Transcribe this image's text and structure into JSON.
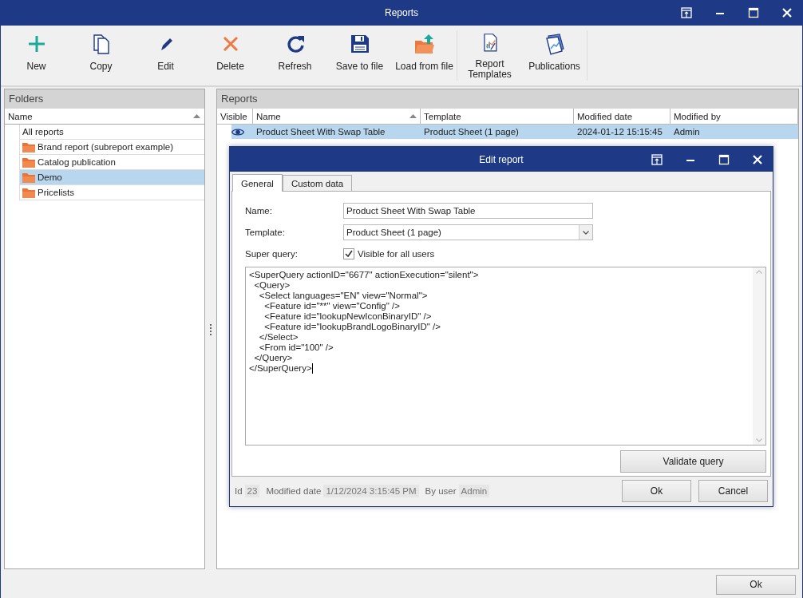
{
  "window": {
    "title": "Reports"
  },
  "toolbar": {
    "groups": [
      [
        {
          "kind": "new",
          "label": "New"
        },
        {
          "kind": "copy",
          "label": "Copy"
        },
        {
          "kind": "edit",
          "label": "Edit"
        },
        {
          "kind": "delete",
          "label": "Delete"
        },
        {
          "kind": "refresh",
          "label": "Refresh"
        },
        {
          "kind": "save",
          "label": "Save to file"
        },
        {
          "kind": "load",
          "label": "Load from file"
        }
      ],
      [
        {
          "kind": "templates",
          "label": "Report Templates"
        },
        {
          "kind": "publications",
          "label": "Publications"
        }
      ]
    ]
  },
  "folders": {
    "title": "Folders",
    "column": "Name",
    "items": [
      {
        "kind": "all",
        "label": "All reports",
        "selected": false
      },
      {
        "kind": "folder",
        "label": "Brand report (subreport example)",
        "selected": false
      },
      {
        "kind": "folder",
        "label": "Catalog publication",
        "selected": false
      },
      {
        "kind": "folder",
        "label": "Demo",
        "selected": true
      },
      {
        "kind": "folder",
        "label": "Pricelists",
        "selected": false
      }
    ]
  },
  "reports": {
    "title": "Reports",
    "columns": [
      "Visible",
      "Name",
      "Template",
      "Modified date",
      "Modified by"
    ],
    "rows": [
      {
        "visible": true,
        "name": "Product Sheet With Swap Table",
        "template": "Product Sheet (1 page)",
        "modified_date": "2024-01-12 15:15:45",
        "modified_by": "Admin",
        "selected": true
      }
    ]
  },
  "dialog": {
    "title": "Edit report",
    "tabs": [
      {
        "label": "General",
        "selected": true
      },
      {
        "label": "Custom data",
        "selected": false
      }
    ],
    "name_label": "Name:",
    "name_value": "Product Sheet With Swap Table",
    "template_label": "Template:",
    "template_value": "Product Sheet (1 page)",
    "super_query_label": "Super query:",
    "visible_checkbox": {
      "label": "Visible for all users",
      "checked": true
    },
    "query_lines": [
      "<SuperQuery actionID=\"6677\" actionExecution=\"silent\">",
      "  <Query>",
      "    <Select languages=\"EN\" view=\"Normal\">",
      "      <Feature id=\"**\" view=\"Config\" />",
      "      <Feature id=\"lookupNewIconBinaryID\" />",
      "      <Feature id=\"lookupBrandLogoBinaryID\" />",
      "    </Select>",
      "    <From id=\"100\" />",
      "  </Query>",
      "</SuperQuery>"
    ],
    "validate_button": "Validate query",
    "footer": {
      "id_label": "Id",
      "id_value": "23",
      "date_label": "Modified date",
      "date_value": "1/12/2024 3:15:45 PM",
      "user_label": "By user",
      "user_value": "Admin"
    },
    "ok_button": "Ok",
    "cancel_button": "Cancel"
  },
  "bottom": {
    "ok_button": "Ok"
  }
}
